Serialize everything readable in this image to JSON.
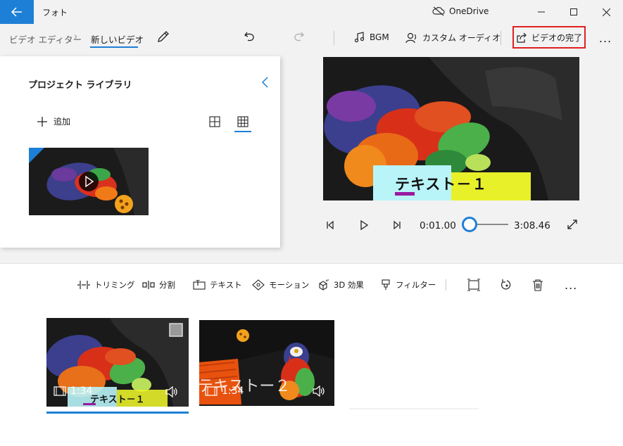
{
  "window": {
    "app_title": "フォト",
    "onedrive_label": "OneDrive"
  },
  "commandbar": {
    "breadcrumb_parent": "ビデオ エディター",
    "breadcrumb_current": "新しいビデオ",
    "bgm_label": "BGM",
    "custom_audio_label": "カスタム オーディオ",
    "finish_video_label": "ビデオの完了",
    "more_label": "..."
  },
  "library": {
    "title": "プロジェクト ライブラリ",
    "add_label": "追加"
  },
  "player": {
    "current_time": "0:01.00",
    "total_time": "3:08.46",
    "progress_fraction": 0.005,
    "overlay_text": "テキスト－１"
  },
  "storyboard": {
    "tools": [
      {
        "label": "トリミング",
        "icon": "trim-icon"
      },
      {
        "label": "分割",
        "icon": "split-icon"
      },
      {
        "label": "テキスト",
        "icon": "text-icon"
      },
      {
        "label": "モーション",
        "icon": "motion-icon"
      },
      {
        "label": "3D 効果",
        "icon": "3d-effects-icon"
      },
      {
        "label": "フィルター",
        "icon": "filter-icon"
      }
    ],
    "clips": [
      {
        "duration": "1:34",
        "caption": "テキスト－１"
      },
      {
        "duration": "1:34",
        "caption": "テキストー２"
      }
    ]
  },
  "colors": {
    "accent": "#1e7fd6",
    "finish_border": "#e02020",
    "caption_cyan": "#b8f4f8",
    "caption_yellow": "#e8f02a",
    "caption_purple": "#9a1aa0"
  }
}
